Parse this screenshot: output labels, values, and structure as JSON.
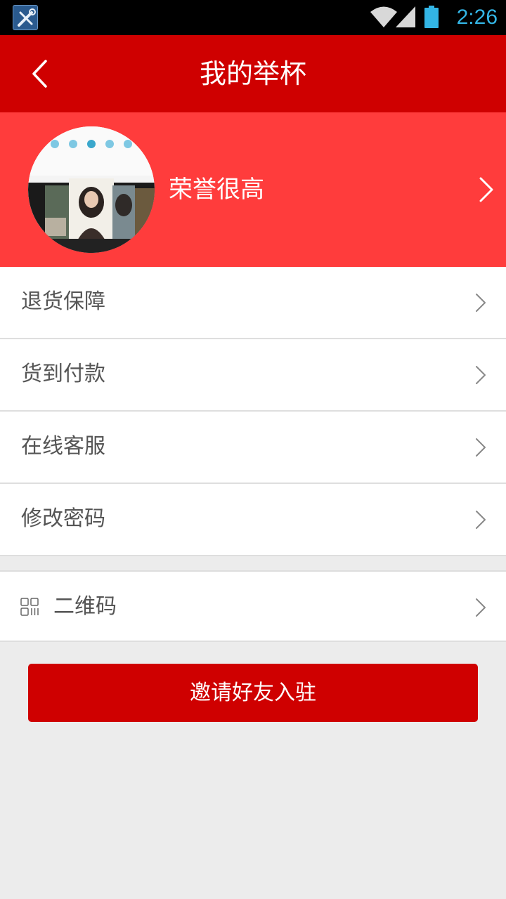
{
  "status_bar": {
    "time": "2:26",
    "app_icon": "tools-icon",
    "wifi_icon": "wifi-icon",
    "signal_icon": "cell-signal-icon",
    "battery_icon": "battery-icon",
    "time_color": "#33b5e5"
  },
  "header": {
    "title": "我的举杯",
    "back_icon": "chevron-left-icon",
    "background_color": "#cf0000"
  },
  "profile": {
    "username": "荣誉很高",
    "avatar_icon": "avatar-photo",
    "background_color": "#ff3c3c"
  },
  "menu": {
    "items": [
      {
        "label": "退货保障"
      },
      {
        "label": "货到付款"
      },
      {
        "label": "在线客服"
      },
      {
        "label": "修改密码"
      }
    ]
  },
  "qr": {
    "label": "二维码",
    "icon": "qr-code-icon"
  },
  "invite_button": {
    "label": "邀请好友入驻"
  }
}
